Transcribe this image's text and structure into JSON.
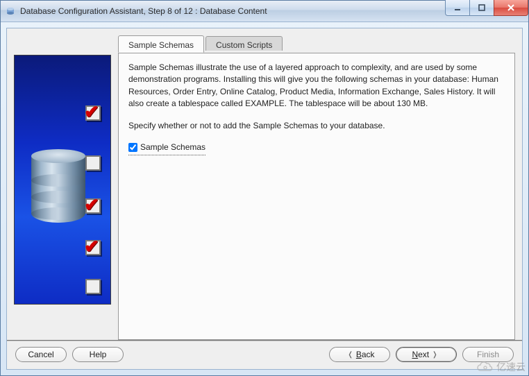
{
  "window": {
    "title": "Database Configuration Assistant, Step 8 of 12 : Database Content"
  },
  "wizard_steps": [
    {
      "checked": true
    },
    {
      "checked": false
    },
    {
      "checked": true
    },
    {
      "checked": true
    },
    {
      "checked": false
    }
  ],
  "tabs": [
    {
      "id": "sample-schemas-tab",
      "label": "Sample Schemas",
      "active": true
    },
    {
      "id": "custom-scripts-tab",
      "label": "Custom Scripts",
      "active": false
    }
  ],
  "body": {
    "paragraph1": "Sample Schemas illustrate the use of a layered approach to complexity, and are used by some demonstration programs. Installing this will give you the following schemas in your database: Human Resources, Order Entry, Online Catalog, Product Media, Information Exchange, Sales History. It will also create a tablespace called EXAMPLE. The tablespace will be about 130 MB.",
    "paragraph2": "Specify whether or not to add the Sample Schemas to your database.",
    "checkbox_label": "Sample Schemas",
    "checkbox_checked": true
  },
  "buttons": {
    "cancel": "Cancel",
    "help": "Help",
    "back_prefix": "B",
    "back_rest": "ack",
    "next_prefix": "N",
    "next_rest": "ext",
    "finish": "Finish"
  },
  "watermark": "亿速云"
}
